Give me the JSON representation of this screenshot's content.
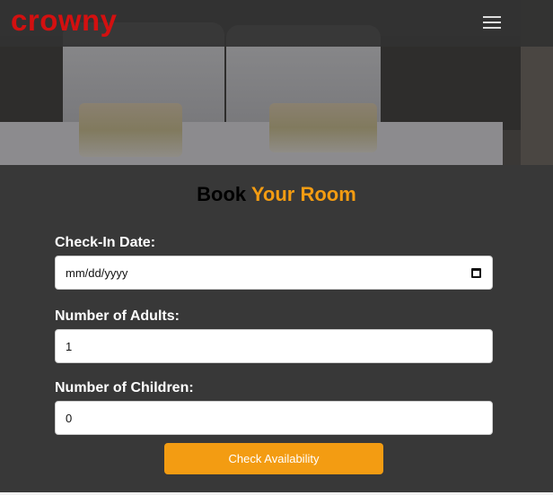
{
  "navbar": {
    "logo": "crowny",
    "menu_icon": "hamburger-icon"
  },
  "form": {
    "title_part1": "Book",
    "title_part2": "Your Room",
    "checkin_label": "Check-In Date:",
    "checkin_placeholder": "mm/dd/yyyy",
    "adults_label": "Number of Adults:",
    "adults_value": "1",
    "children_label": "Number of Children:",
    "children_value": "0",
    "submit_label": "Check Availability"
  },
  "colors": {
    "accent": "#f39c12",
    "logo": "#d31010",
    "background": "#383838"
  }
}
